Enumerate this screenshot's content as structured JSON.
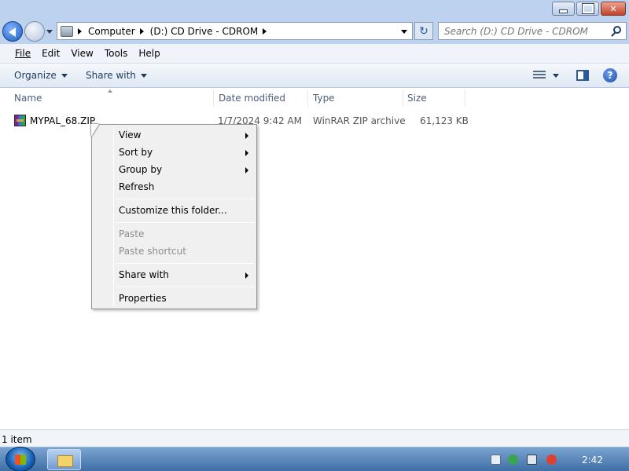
{
  "window": {
    "min_label": "",
    "max_label": "",
    "close_label": "✕"
  },
  "address": {
    "crumbs": [
      "Computer",
      "(D:) CD Drive - CDROM"
    ],
    "search_placeholder": "Search (D:) CD Drive - CDROM"
  },
  "menubar": {
    "items": [
      "File",
      "Edit",
      "View",
      "Tools",
      "Help"
    ]
  },
  "toolbar": {
    "organize": "Organize",
    "share_with": "Share with",
    "help_glyph": "?",
    "refresh_glyph": "↻"
  },
  "columns": {
    "name": "Name",
    "date_modified": "Date modified",
    "type": "Type",
    "size": "Size"
  },
  "files": [
    {
      "name": "MYPAL_68.ZIP",
      "date_modified": "1/7/2024 9:42 AM",
      "type": "WinRAR ZIP archive",
      "size": "61,123 KB",
      "icon": "winrar-zip-icon"
    }
  ],
  "context_menu": {
    "items": [
      {
        "label": "View",
        "submenu": true,
        "enabled": true
      },
      {
        "label": "Sort by",
        "submenu": true,
        "enabled": true
      },
      {
        "label": "Group by",
        "submenu": true,
        "enabled": true
      },
      {
        "label": "Refresh",
        "submenu": false,
        "enabled": true
      },
      {
        "label": "Customize this folder...",
        "submenu": false,
        "enabled": true
      },
      {
        "label": "Paste",
        "submenu": false,
        "enabled": false
      },
      {
        "label": "Paste shortcut",
        "submenu": false,
        "enabled": false
      },
      {
        "label": "Share with",
        "submenu": true,
        "enabled": true
      },
      {
        "label": "Properties",
        "submenu": false,
        "enabled": true
      }
    ]
  },
  "status": {
    "item_count": "1 item"
  },
  "taskbar": {
    "clock": "2:42"
  },
  "colors": {
    "chrome": "#bcd2ee",
    "taskbar": "#3f6fa6",
    "disabled_text": "#8d8d8d"
  }
}
